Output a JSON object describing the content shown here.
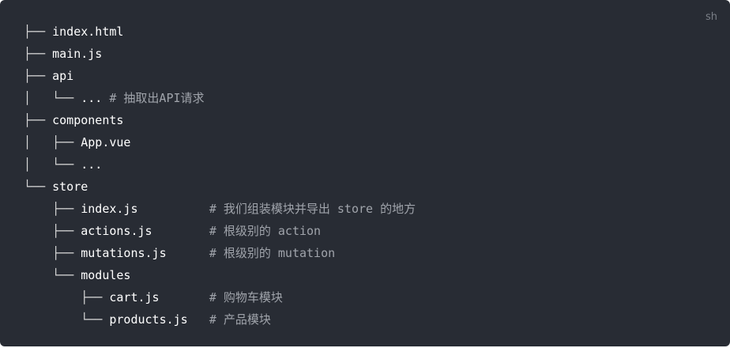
{
  "code_block": {
    "language": "sh",
    "lines": [
      {
        "tree": "├── ",
        "name": "index.html",
        "pad": "",
        "comment": ""
      },
      {
        "tree": "├── ",
        "name": "main.js",
        "pad": "",
        "comment": ""
      },
      {
        "tree": "├── ",
        "name": "api",
        "pad": "",
        "comment": ""
      },
      {
        "tree": "│   └── ",
        "name": "...",
        "pad": " ",
        "comment": "# 抽取出API请求"
      },
      {
        "tree": "├── ",
        "name": "components",
        "pad": "",
        "comment": ""
      },
      {
        "tree": "│   ├── ",
        "name": "App.vue",
        "pad": "",
        "comment": ""
      },
      {
        "tree": "│   └── ",
        "name": "...",
        "pad": "",
        "comment": ""
      },
      {
        "tree": "└── ",
        "name": "store",
        "pad": "",
        "comment": ""
      },
      {
        "tree": "    ├── ",
        "name": "index.js",
        "pad": "          ",
        "comment": "# 我们组装模块并导出 store 的地方"
      },
      {
        "tree": "    ├── ",
        "name": "actions.js",
        "pad": "        ",
        "comment": "# 根级别的 action"
      },
      {
        "tree": "    ├── ",
        "name": "mutations.js",
        "pad": "      ",
        "comment": "# 根级别的 mutation"
      },
      {
        "tree": "    └── ",
        "name": "modules",
        "pad": "",
        "comment": ""
      },
      {
        "tree": "        ├── ",
        "name": "cart.js",
        "pad": "       ",
        "comment": "# 购物车模块"
      },
      {
        "tree": "        └── ",
        "name": "products.js",
        "pad": "   ",
        "comment": "# 产品模块"
      }
    ]
  }
}
